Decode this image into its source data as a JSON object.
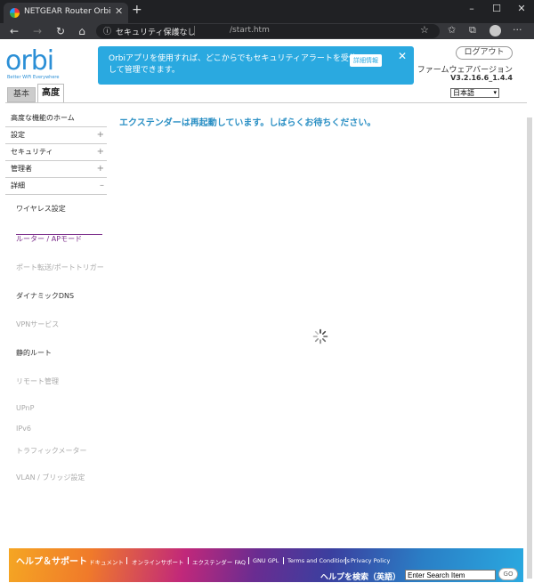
{
  "browser": {
    "tab_title": "NETGEAR Router Orbi",
    "tab_close": "✕",
    "new_tab": "+",
    "window_controls": [
      "–",
      "☐",
      "✕"
    ],
    "security_label": "セキュリティ保護なし",
    "url": "/start.htm",
    "nav": {
      "back": "←",
      "forward": "→",
      "reload": "↻",
      "home": "⌂"
    },
    "more": "···"
  },
  "header": {
    "logo_word": "orbi",
    "logo_tagline": "Better WiFi Everywhere",
    "banner_message": "Orbiアプリを使用すれば、どこからでもセキュリティアラートを受信して管理できます。",
    "banner_more": "詳細情報",
    "banner_close": "✕",
    "logout": "ログアウト",
    "firmware_label": "ファームウェアバージョン",
    "firmware_version": "V3.2.16.6_1.4.4",
    "language": "日本語",
    "language_caret": "▾"
  },
  "tabs": {
    "basic": "基本",
    "advanced": "高度"
  },
  "sidebar": {
    "main_items": [
      {
        "label": "高度な機能のホーム",
        "marker": ""
      },
      {
        "label": "設定",
        "marker": "+"
      },
      {
        "label": "セキュリティ",
        "marker": "+"
      },
      {
        "label": "管理者",
        "marker": "+"
      },
      {
        "label": "詳細",
        "marker": "–"
      }
    ],
    "sub_items": [
      {
        "label": "ワイヤレス設定",
        "state": "normal"
      },
      {
        "label": "ルーター / APモード",
        "state": "active"
      },
      {
        "label": "ポート転送/ポートトリガー",
        "state": "dim"
      },
      {
        "label": "ダイナミックDNS",
        "state": "normal"
      },
      {
        "label": "VPNサービス",
        "state": "dim"
      },
      {
        "label": "静的ルート",
        "state": "normal"
      },
      {
        "label": "リモート管理",
        "state": "dim"
      },
      {
        "label": "UPnP",
        "state": "dim"
      },
      {
        "label": "IPv6",
        "state": "dim"
      },
      {
        "label": "トラフィックメーター",
        "state": "dim"
      },
      {
        "label": "VLAN / ブリッジ設定",
        "state": "dim"
      }
    ]
  },
  "main": {
    "reboot_message": "エクステンダーは再起動しています。しばらくお待ちください。"
  },
  "footer": {
    "title": "ヘルプ＆サポート",
    "links": [
      "ドキュメント",
      "オンラインサポート",
      "エクステンダー FAQ",
      "GNU GPL",
      "Terms and Conditions",
      "Privacy Policy"
    ],
    "search_label": "ヘルプを検索（英語）",
    "search_placeholder": "Enter Search Item",
    "go": "GO"
  }
}
